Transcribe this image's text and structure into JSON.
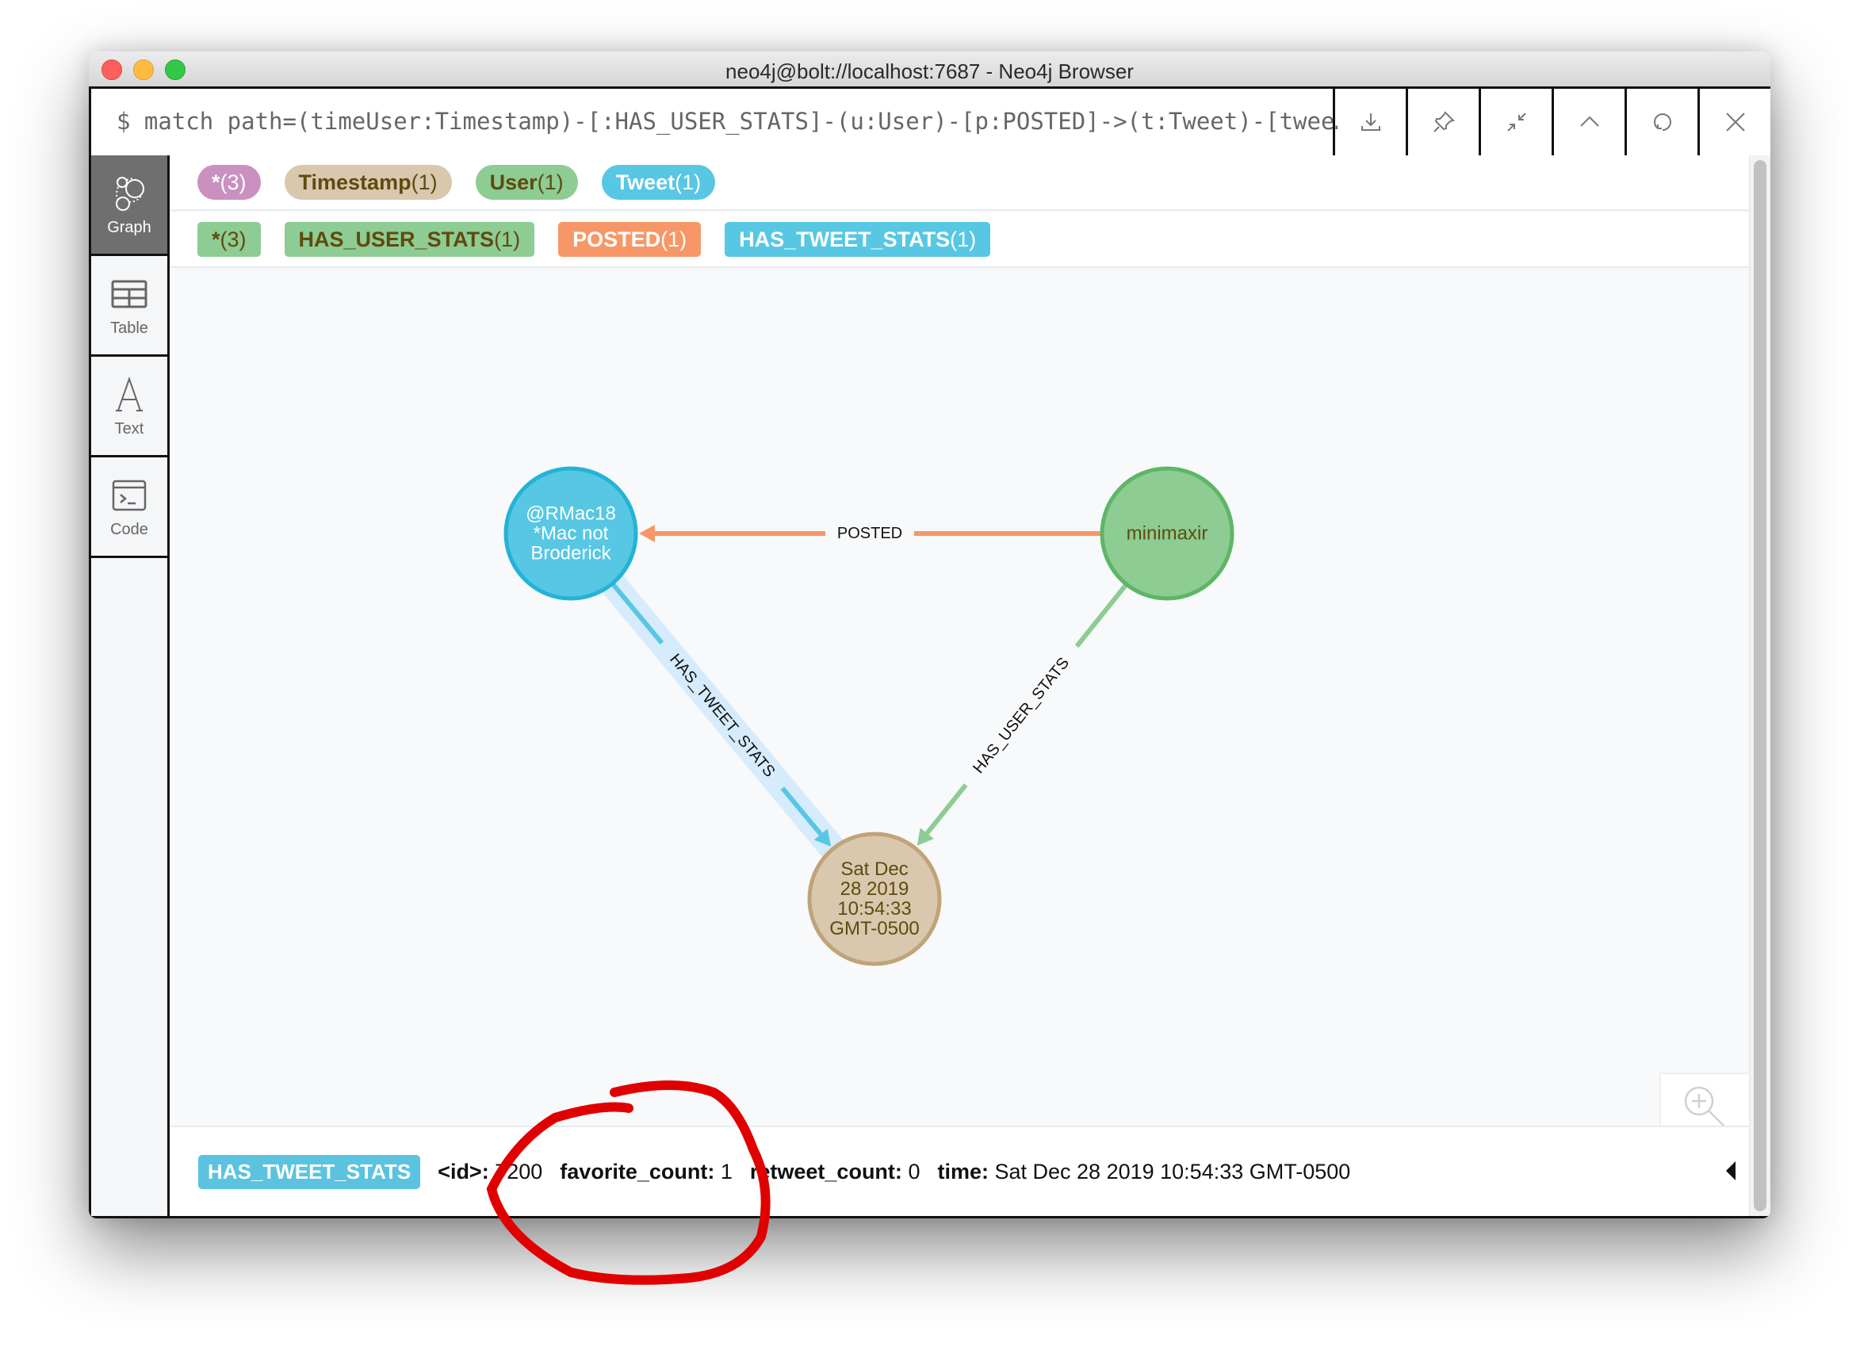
{
  "window": {
    "title": "neo4j@bolt://localhost:7687 - Neo4j Browser"
  },
  "query": {
    "text": "$ match path=(timeUser:Timestamp)-[:HAS_USER_STATS]-(u:User)-[p:POSTED]->(t:Tweet)-[twee…",
    "buttons": [
      {
        "name": "download",
        "icon": "download-icon"
      },
      {
        "name": "pin",
        "icon": "pin-icon"
      },
      {
        "name": "collapse",
        "icon": "collapse-icon"
      },
      {
        "name": "fold-up",
        "icon": "chevron-up-icon"
      },
      {
        "name": "rerun",
        "icon": "refresh-icon"
      },
      {
        "name": "close",
        "icon": "close-icon"
      }
    ]
  },
  "sidebar": {
    "items": [
      {
        "label": "Graph",
        "icon": "graph-icon",
        "active": true
      },
      {
        "label": "Table",
        "icon": "table-icon",
        "active": false
      },
      {
        "label": "Text",
        "icon": "text-icon",
        "active": false
      },
      {
        "label": "Code",
        "icon": "code-icon",
        "active": false
      }
    ]
  },
  "node_labels": [
    {
      "name": "*",
      "count": "(3)",
      "bg": "#c990c0",
      "fg": "#ffffff"
    },
    {
      "name": "Timestamp",
      "count": "(1)",
      "bg": "#d9c8ae",
      "fg": "#604a0e"
    },
    {
      "name": "User",
      "count": "(1)",
      "bg": "#8dcc93",
      "fg": "#604a0e"
    },
    {
      "name": "Tweet",
      "count": "(1)",
      "bg": "#57c7e3",
      "fg": "#ffffff"
    }
  ],
  "rel_types": [
    {
      "name": "*",
      "count": "(3)",
      "bg": "#8dcc93",
      "fg": "#604a0e"
    },
    {
      "name": "HAS_USER_STATS",
      "count": "(1)",
      "bg": "#8dcc93",
      "fg": "#604a0e"
    },
    {
      "name": "POSTED",
      "count": "(1)",
      "bg": "#f79767",
      "fg": "#ffffff"
    },
    {
      "name": "HAS_TWEET_STATS",
      "count": "(1)",
      "bg": "#57c7e3",
      "fg": "#ffffff"
    }
  ],
  "graph": {
    "nodes": [
      {
        "id": "tweet",
        "label": "Tweet",
        "lines": [
          "@RMac18",
          "*Mac not",
          "Broderick"
        ],
        "fill": "#57c7e3",
        "stroke": "#23b3d7",
        "text": "#ffffff"
      },
      {
        "id": "user",
        "label": "User",
        "lines": [
          "minimaxir"
        ],
        "fill": "#8dcc93",
        "stroke": "#5db665",
        "text": "#604a0e"
      },
      {
        "id": "timestamp",
        "label": "Timestamp",
        "lines": [
          "Sat Dec",
          "28 2019",
          "10:54:33",
          "GMT-0500"
        ],
        "fill": "#d9c8ae",
        "stroke": "#c0a378",
        "text": "#604a0e"
      }
    ],
    "relationships": [
      {
        "type": "POSTED",
        "from": "user",
        "to": "tweet",
        "color": "#f79767",
        "selected": false
      },
      {
        "type": "HAS_TWEET_STATS",
        "from": "tweet",
        "to": "timestamp",
        "color": "#57c7e3",
        "selected": true
      },
      {
        "type": "HAS_USER_STATS",
        "from": "user",
        "to": "timestamp",
        "color": "#8dcc93",
        "selected": false
      }
    ]
  },
  "zoom_controls": {
    "zoom_in": "zoom-in-icon",
    "zoom_out": "zoom-out-icon"
  },
  "details": {
    "type": "HAS_TWEET_STATS",
    "properties": [
      {
        "key": "<id>:",
        "value": "7200"
      },
      {
        "key": "favorite_count:",
        "value": "1"
      },
      {
        "key": "retweet_count:",
        "value": "0"
      },
      {
        "key": "time:",
        "value": "Sat Dec 28 2019 10:54:33 GMT-0500"
      }
    ]
  },
  "annotation": {
    "color": "#e00000",
    "target": "favorite_count"
  }
}
